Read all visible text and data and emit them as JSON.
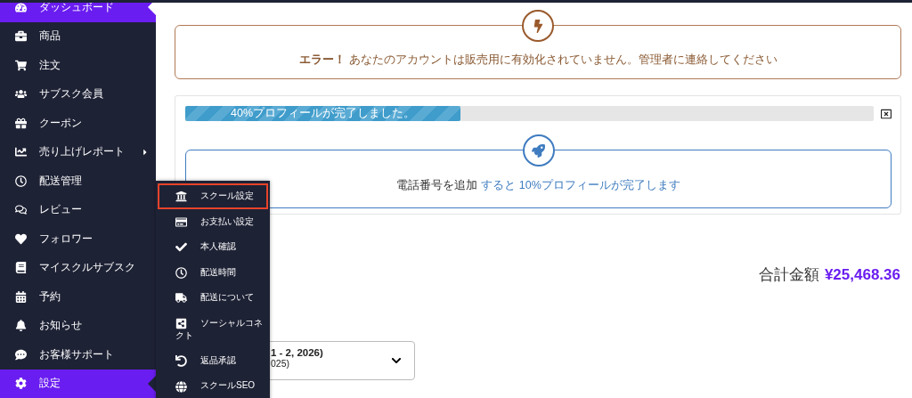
{
  "sidebar": {
    "items": [
      {
        "label": "ダッシュボード",
        "selected": true,
        "has_submenu": false
      },
      {
        "label": "商品",
        "selected": false,
        "has_submenu": false
      },
      {
        "label": "注文",
        "selected": false,
        "has_submenu": false
      },
      {
        "label": "サブスク会員",
        "selected": false,
        "has_submenu": false
      },
      {
        "label": "クーポン",
        "selected": false,
        "has_submenu": false
      },
      {
        "label": "売り上げレポート",
        "selected": false,
        "has_submenu": true
      },
      {
        "label": "配送管理",
        "selected": false,
        "has_submenu": false
      },
      {
        "label": "レビュー",
        "selected": false,
        "has_submenu": false
      },
      {
        "label": "フォロワー",
        "selected": false,
        "has_submenu": false
      },
      {
        "label": "マイスクルサブスク",
        "selected": false,
        "has_submenu": false
      },
      {
        "label": "予約",
        "selected": false,
        "has_submenu": false
      },
      {
        "label": "お知らせ",
        "selected": false,
        "has_submenu": false
      },
      {
        "label": "お客様サポート",
        "selected": false,
        "has_submenu": false
      },
      {
        "label": "設定",
        "selected": true,
        "has_submenu": false
      }
    ]
  },
  "submenu": {
    "items": [
      {
        "label": "スクール設定",
        "selected": true
      },
      {
        "label": "お支払い設定",
        "selected": false
      },
      {
        "label": "本人確認",
        "selected": false
      },
      {
        "label": "配送時間",
        "selected": false
      },
      {
        "label": "配送について",
        "selected": false
      },
      {
        "label": "ソーシャルコネクト",
        "selected": false
      },
      {
        "label": "返品承認",
        "selected": false
      },
      {
        "label": "スクールSEO",
        "selected": false
      }
    ]
  },
  "error": {
    "title": "エラー！",
    "message": "あなたのアカウントは販売用に有効化されていません。管理者に連絡してください"
  },
  "profile": {
    "progress": {
      "level": 0.4,
      "label": "40%プロフィールが完了しました。"
    },
    "hint": {
      "text": "電話番号を追加",
      "link": "すると 10%プロフィールが完了します"
    }
  },
  "total": {
    "label": "合計金額",
    "amount": "¥25,468.36"
  },
  "date_select": {
    "line_1": "1 - 2, 2026)",
    "line_2": "025)"
  }
}
